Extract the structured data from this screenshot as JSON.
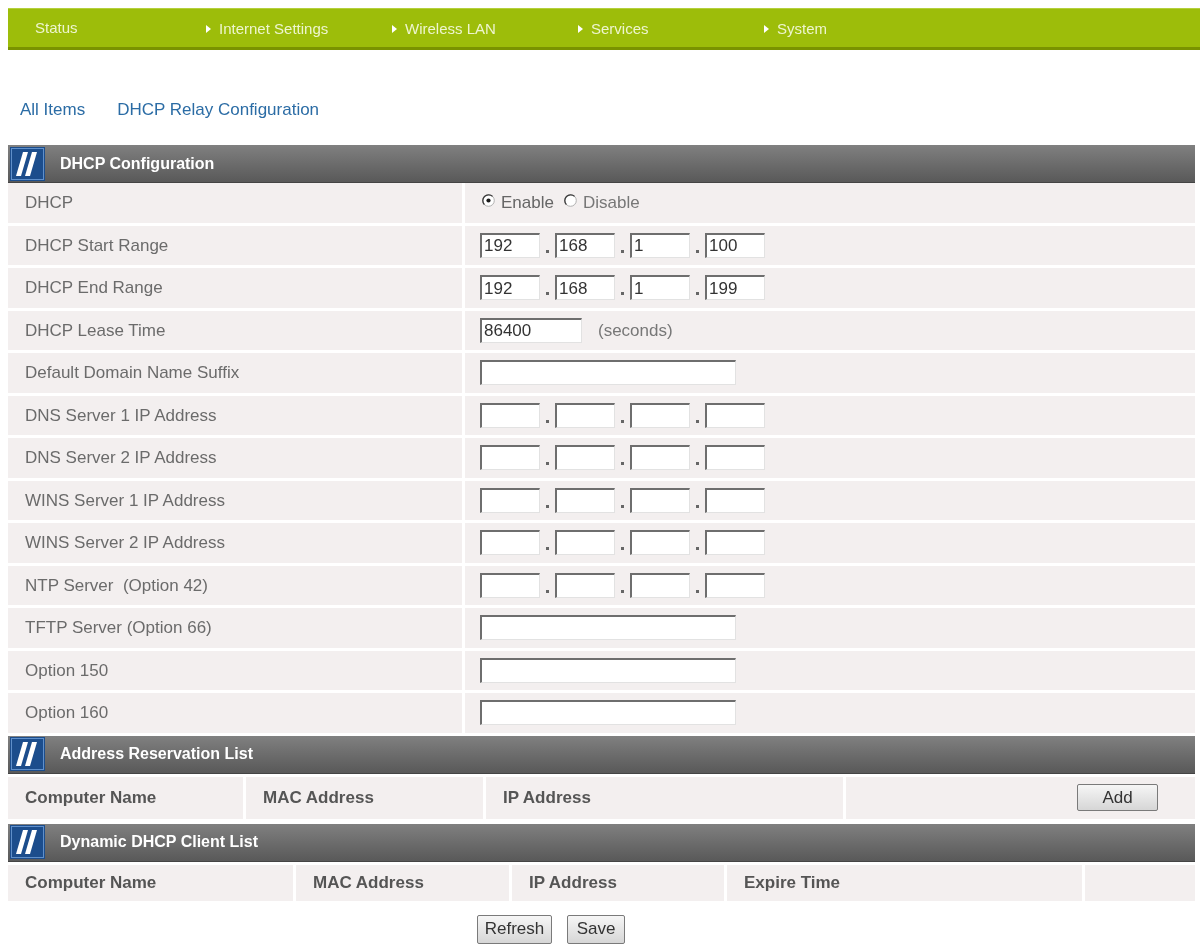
{
  "nav": {
    "items": [
      {
        "label": "Status",
        "arrow": false
      },
      {
        "label": "Internet Settings",
        "arrow": true
      },
      {
        "label": "Wireless LAN",
        "arrow": true
      },
      {
        "label": "Services",
        "arrow": true
      },
      {
        "label": "System",
        "arrow": true
      }
    ]
  },
  "breadcrumbs": [
    {
      "label": "All Items"
    },
    {
      "label": "DHCP Relay Configuration"
    }
  ],
  "dhcp_configuration": {
    "title": "DHCP Configuration",
    "rows": [
      {
        "label": "DHCP",
        "kind": "radio",
        "options": [
          {
            "label": "Enable",
            "selected": true
          },
          {
            "label": "Disable",
            "selected": false
          }
        ]
      },
      {
        "label": "DHCP Start Range",
        "kind": "ip",
        "values": [
          "192",
          "168",
          "1",
          "100"
        ]
      },
      {
        "label": "DHCP End Range",
        "kind": "ip",
        "values": [
          "192",
          "168",
          "1",
          "199"
        ]
      },
      {
        "label": "DHCP Lease Time",
        "kind": "short_text",
        "value": "86400",
        "unit": "(seconds)"
      },
      {
        "label": "Default Domain Name Suffix",
        "kind": "text"
      },
      {
        "label": "DNS Server 1 IP Address",
        "kind": "ip"
      },
      {
        "label": "DNS Server 2 IP Address",
        "kind": "ip"
      },
      {
        "label": "WINS Server 1 IP Address",
        "kind": "ip"
      },
      {
        "label": "WINS Server 2 IP Address",
        "kind": "ip"
      },
      {
        "label": "NTP Server  (Option 42)",
        "kind": "ip"
      },
      {
        "label": "TFTP Server (Option 66)",
        "kind": "text"
      },
      {
        "label": "Option 150",
        "kind": "text"
      },
      {
        "label": "Option 160",
        "kind": "text"
      }
    ]
  },
  "tables": [
    {
      "kind": "reservation",
      "title": "Address Reservation List",
      "columns": [
        "Computer Name",
        "MAC Address",
        "IP Address"
      ],
      "button": "Add"
    },
    {
      "kind": "clients",
      "title": "Dynamic DHCP Client List",
      "columns": [
        "Computer Name",
        "MAC Address",
        "IP Address",
        "Expire Time"
      ]
    }
  ],
  "buttons": [
    "Refresh",
    "Save"
  ]
}
